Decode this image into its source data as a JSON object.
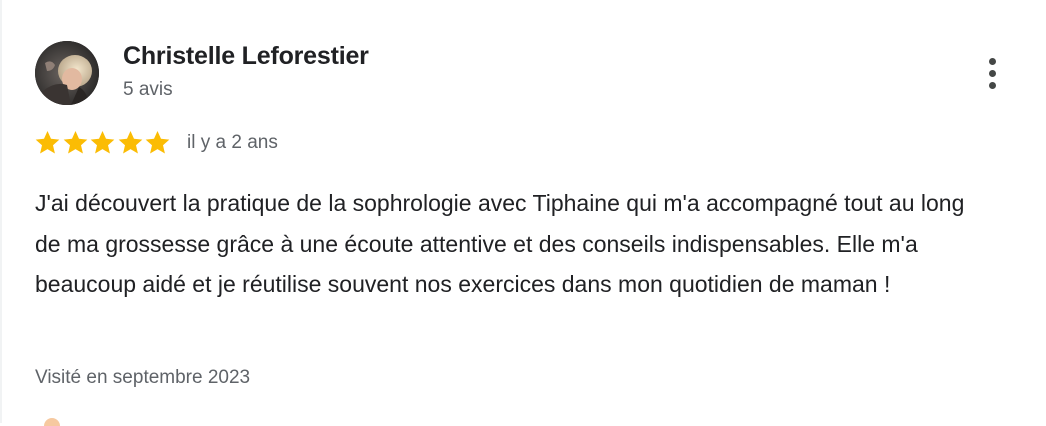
{
  "review": {
    "author": {
      "name": "Christelle Leforestier",
      "review_count": "5 avis",
      "avatar_icon": "user-photo"
    },
    "rating": 5,
    "rating_max": 5,
    "date": "il y a 2 ans",
    "text": "J'ai découvert la pratique de la sophrologie avec Tiphaine qui m'a accompagné tout au long de ma grossesse grâce à une écoute attentive et des conseils indispensables. Elle m'a beaucoup aidé et je réutilise souvent nos exercices dans mon quotidien de maman !",
    "visit": "Visité en septembre 2023",
    "menu_icon": "more-vert-icon"
  },
  "colors": {
    "star": "#fbbc04",
    "primary_text": "#202124",
    "secondary_text": "#5f6368"
  }
}
